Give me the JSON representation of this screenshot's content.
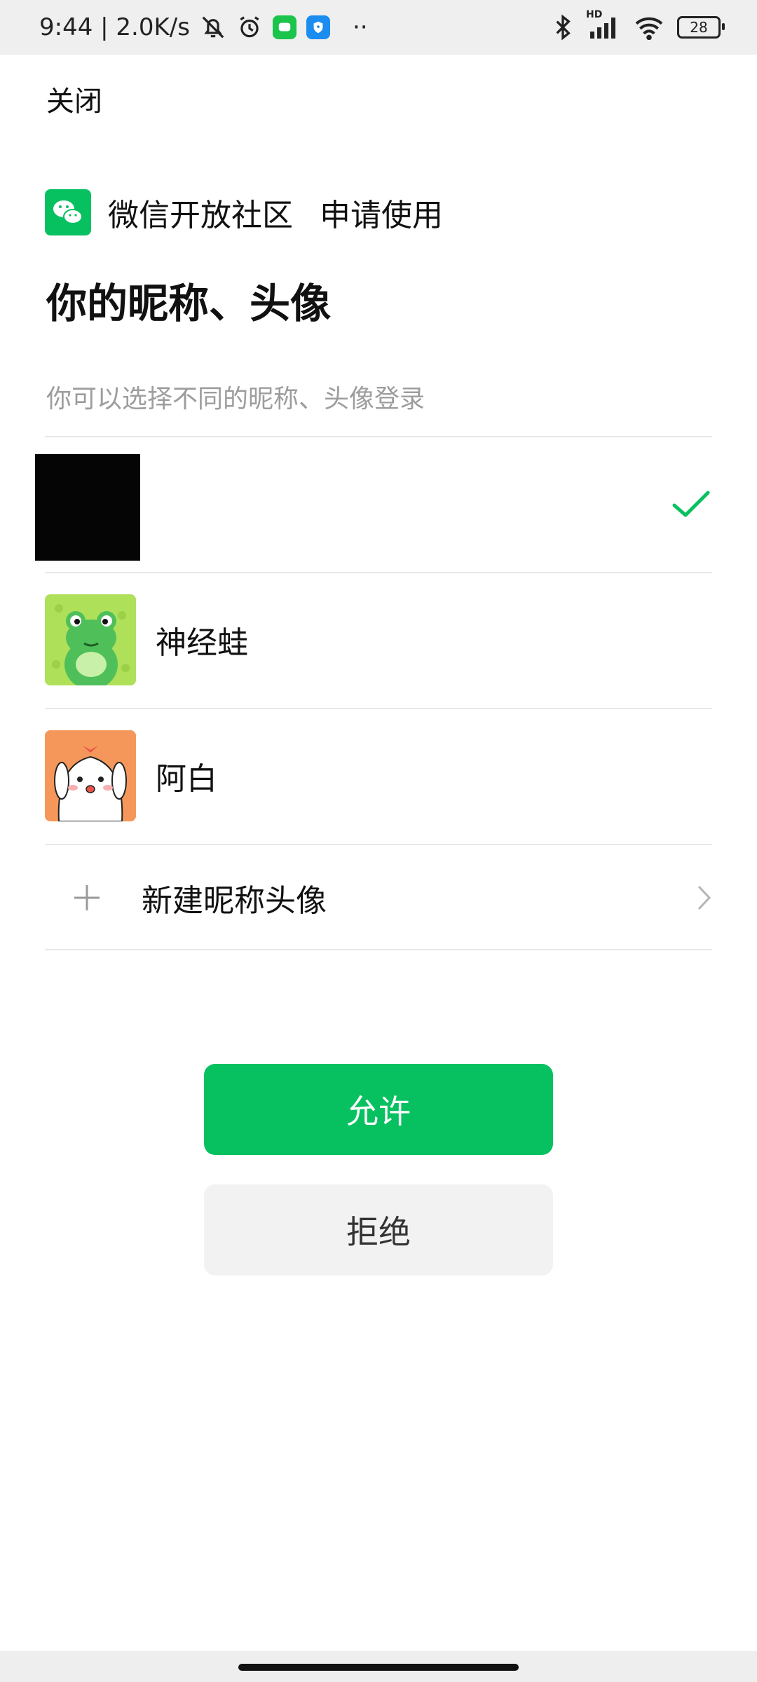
{
  "status_bar": {
    "time_speed": "9:44 | 2.0K/s",
    "dots": "··",
    "hd": "HD",
    "battery": "28",
    "icons": [
      "bell-off-icon",
      "alarm-icon",
      "message-app-icon",
      "shield-app-icon",
      "bluetooth-icon",
      "signal-icon",
      "wifi-icon",
      "battery-icon"
    ],
    "app_badge_colors": {
      "message": "#1bc44a",
      "shield": "#1b8cf0"
    }
  },
  "nav": {
    "close_label": "关闭"
  },
  "header": {
    "app_name": "微信开放社区",
    "action": "申请使用"
  },
  "page": {
    "title": "你的昵称、头像",
    "subtitle": "你可以选择不同的昵称、头像登录"
  },
  "accounts": [
    {
      "nickname": "",
      "selected": true
    },
    {
      "nickname": "神经蛙",
      "selected": false
    },
    {
      "nickname": "阿白",
      "selected": false
    }
  ],
  "new_profile": {
    "label": "新建昵称头像"
  },
  "buttons": {
    "allow": "允许",
    "deny": "拒绝"
  },
  "colors": {
    "accent": "#07c160",
    "deny_bg": "#f2f2f2"
  }
}
